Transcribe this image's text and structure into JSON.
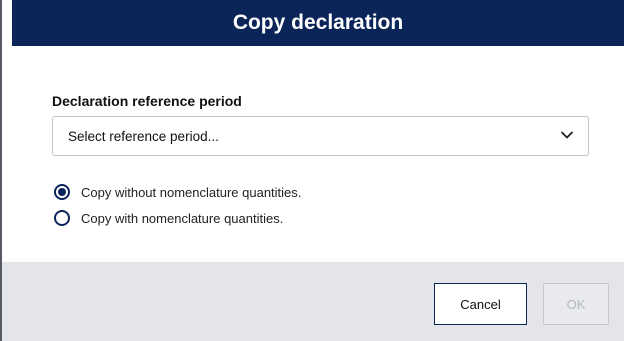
{
  "dialog": {
    "title": "Copy declaration",
    "field_label": "Declaration reference period",
    "select": {
      "value": "Select reference period...",
      "icon": "chevron-down-icon"
    },
    "options": [
      {
        "label": "Copy without nomenclature quantities.",
        "checked": true
      },
      {
        "label": "Copy with nomenclature quantities.",
        "checked": false
      }
    ],
    "buttons": {
      "cancel": "Cancel",
      "ok": "OK",
      "ok_disabled": true
    }
  },
  "colors": {
    "title_bar": "#0b2559",
    "footer_bg": "#e4e5ea",
    "accent": "#0b2559"
  }
}
